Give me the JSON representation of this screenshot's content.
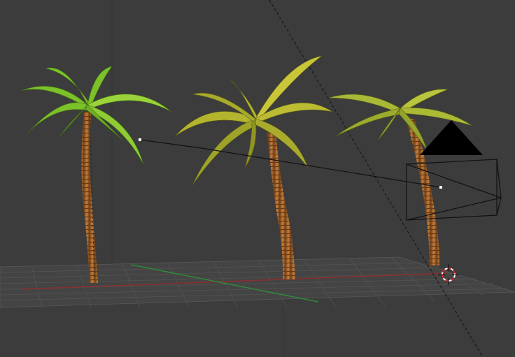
{
  "viewport": {
    "background": "#3c3c3c",
    "grid_color": "#555555",
    "x_axis_color": "#8a2f2f",
    "y_axis_color": "#2f8a3a",
    "objects": [
      {
        "name": "palm-tree",
        "index": 1,
        "frond_color": "#7fc22a",
        "trunk_color": "#b06a2e"
      },
      {
        "name": "palm-tree",
        "index": 2,
        "frond_color": "#b5b830",
        "trunk_color": "#b06a2e"
      },
      {
        "name": "palm-tree",
        "index": 3,
        "frond_color": "#a8b835",
        "trunk_color": "#b06a2e"
      },
      {
        "name": "camera",
        "color": "#000000"
      },
      {
        "name": "3d-cursor",
        "colors": [
          "#d02020",
          "#ffffff"
        ]
      }
    ]
  }
}
